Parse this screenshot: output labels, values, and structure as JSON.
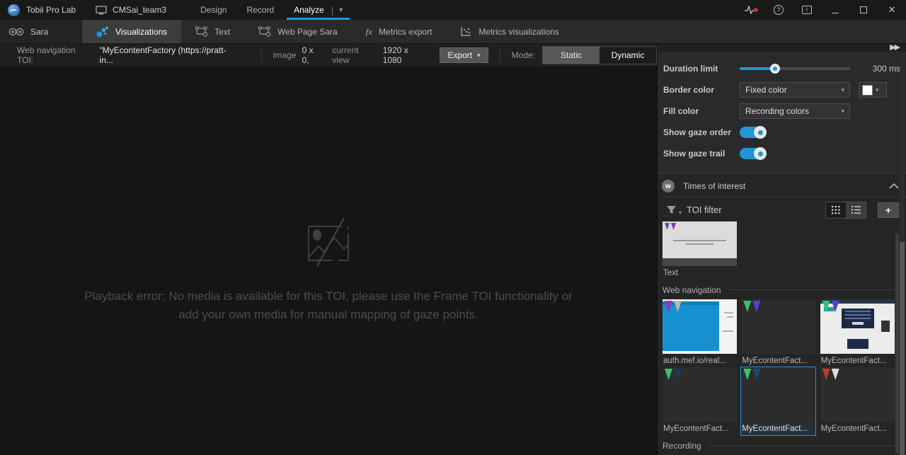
{
  "titlebar": {
    "app_title": "Tobii Pro Lab",
    "project_name": "CMSai_team3",
    "tabs": {
      "design": "Design",
      "record": "Record",
      "analyze": "Analyze"
    },
    "accent_color": "#2196d4"
  },
  "module_bar": {
    "recording_name": "Sara",
    "tabs": [
      {
        "label": "Visualizations",
        "active": true
      },
      {
        "label": "Text",
        "active": false
      },
      {
        "label": "Web Page Sara",
        "active": false
      },
      {
        "label": "Metrics export",
        "active": false
      },
      {
        "label": "Metrics visualizations",
        "active": false
      }
    ]
  },
  "toolbar": {
    "toi_label": "Web navigation TOI:",
    "toi_value": "\"MyEcontentFactory (https://pratt-in...",
    "image_label": "image",
    "image_value": "0 x 0,",
    "view_label": "current view",
    "view_value": "1920 x 1080",
    "export_label": "Export",
    "mode_label": "Mode:",
    "mode_static": "Static",
    "mode_dynamic": "Dynamic",
    "mode_selected": "Dynamic"
  },
  "viewer": {
    "error_line1": "Playback error: No media is available for this TOI, please use the Frame TOI functionality or",
    "error_line2": "add your own media for manual mapping of gaze points."
  },
  "settings": {
    "duration_limit": {
      "label": "Duration limit",
      "value": "300 ms",
      "percent": 32
    },
    "border_color": {
      "label": "Border color",
      "value": "Fixed color",
      "swatch_color": "#ffffff"
    },
    "fill_color": {
      "label": "Fill color",
      "value": "Recording colors"
    },
    "show_gaze_order": {
      "label": "Show gaze order",
      "enabled": true
    },
    "show_gaze_trail": {
      "label": "Show gaze trail",
      "enabled": true
    }
  },
  "toi_panel": {
    "section_title": "Times of interest",
    "filter_label": "TOI filter",
    "text_item": {
      "label": "Text",
      "pins": [
        "#4653c8",
        "#7a3fae"
      ]
    },
    "web_navigation": {
      "title": "Web navigation",
      "items": [
        {
          "label": "auth.mef.io/real...",
          "pins": [
            "#8b3fae",
            "#b9b9b1"
          ]
        },
        {
          "label": "MyEcontentFact...",
          "pins": [
            "#35c471",
            "#4b44d4"
          ]
        },
        {
          "label": "MyEcontentFact...",
          "pins": [
            "#35c471",
            "#4b44d4"
          ]
        },
        {
          "label": "MyEcontentFact...",
          "pins": [
            "#35c471",
            "#1d3a5e"
          ]
        },
        {
          "label": "MyEcontentFact...",
          "pins": [
            "#35c471",
            "#1d4a6e"
          ],
          "selected": true
        },
        {
          "label": "MyEcontentFact...",
          "pins": [
            "#c23b2e",
            "#dcdcd8"
          ]
        }
      ]
    },
    "recording_title": "Recording"
  }
}
